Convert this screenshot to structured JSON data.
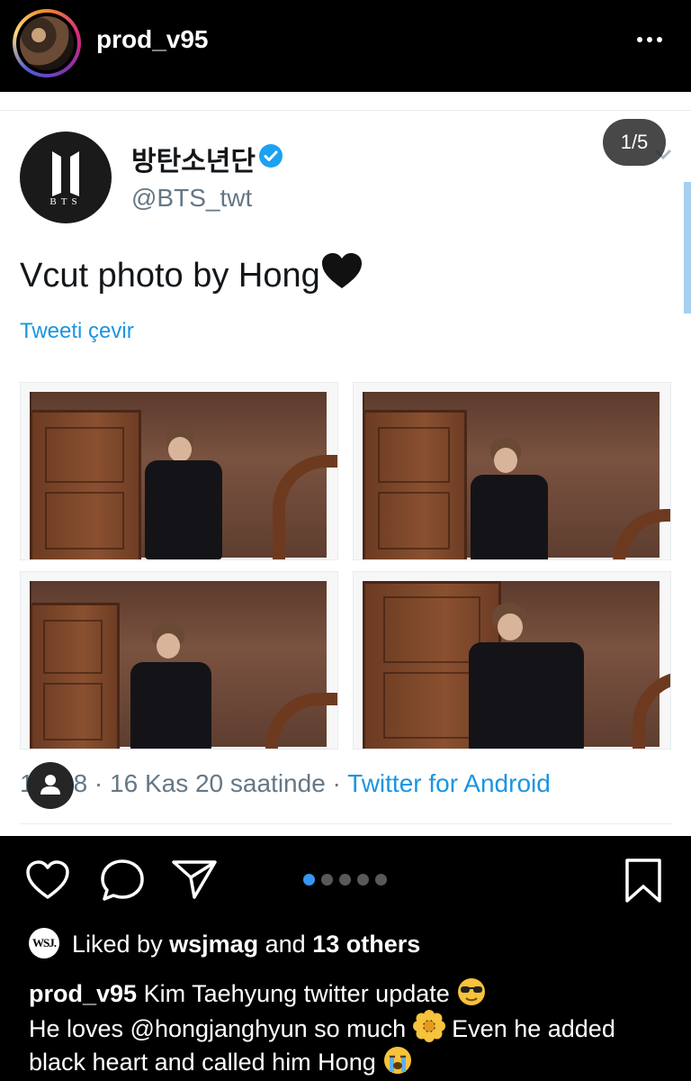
{
  "header": {
    "username": "prod_v95",
    "more_icon": "more-horizontal-icon"
  },
  "tweet": {
    "display_name": "방탄소년단",
    "handle": "@BTS_twt",
    "logo_text": "BTS",
    "text": "Vcut photo by Hong",
    "translate": "Tweeti çevir",
    "carousel_badge": "1/5",
    "meta_prefix": "1",
    "meta_time": "8 · 16 Kas 20 saatinde · ",
    "meta_source": "Twitter for Android",
    "photos": [
      "photo-1",
      "photo-2",
      "photo-3",
      "photo-4"
    ],
    "verified_color": "#1da1f2",
    "link_color": "#1b95e0"
  },
  "actions": {
    "like_icon": "heart-icon",
    "comment_icon": "comment-icon",
    "share_icon": "send-icon",
    "save_icon": "bookmark-icon",
    "carousel_total": 5,
    "carousel_active": 1
  },
  "likes": {
    "avatar_text": "WSJ.",
    "prefix": "Liked by ",
    "user": "wsjmag",
    "middle": " and ",
    "others": "13 others"
  },
  "caption": {
    "username": "prod_v95",
    "line1": " Kim Taehyung twitter update ",
    "line2a": "He loves @hongjanghyun so much ",
    "line2b": " Even he added black heart and called him Hong "
  }
}
